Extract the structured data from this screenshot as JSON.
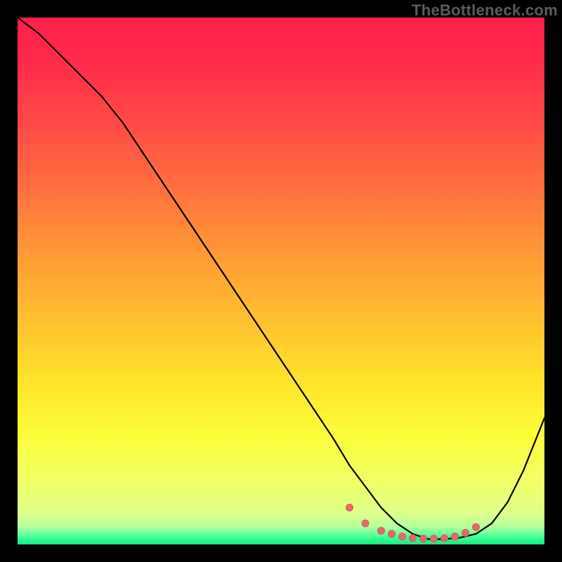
{
  "watermark": "TheBottleneck.com",
  "colors": {
    "curve": "#000000",
    "dot_fill": "#e46a6a",
    "dot_stroke": "#d85a5a"
  },
  "dot_radius": 5,
  "chart_data": {
    "type": "line",
    "title": "",
    "xlabel": "",
    "ylabel": "",
    "xlim": [
      0,
      100
    ],
    "ylim": [
      0,
      100
    ],
    "grid": false,
    "series": [
      {
        "name": "bottleneck_curve",
        "x": [
          0,
          4,
          8,
          12,
          16,
          20,
          24,
          28,
          32,
          36,
          40,
          44,
          48,
          52,
          56,
          60,
          63,
          66,
          69,
          72,
          75,
          78,
          81,
          84,
          87,
          90,
          93,
          96,
          100
        ],
        "y": [
          100,
          97,
          93,
          89,
          85,
          80,
          74,
          68,
          62,
          56,
          50,
          44,
          38,
          32,
          26,
          20,
          15,
          11,
          7,
          4,
          2,
          1,
          1,
          1.3,
          2,
          4,
          8,
          14,
          24
        ]
      }
    ],
    "optimum_dots": {
      "name": "flat_region_markers",
      "x": [
        63,
        66,
        69,
        71,
        73,
        75,
        77,
        79,
        81,
        83,
        85,
        87
      ],
      "y": [
        7,
        4,
        2.6,
        2.0,
        1.5,
        1.2,
        1.1,
        1.1,
        1.2,
        1.5,
        2.2,
        3.3
      ]
    }
  }
}
